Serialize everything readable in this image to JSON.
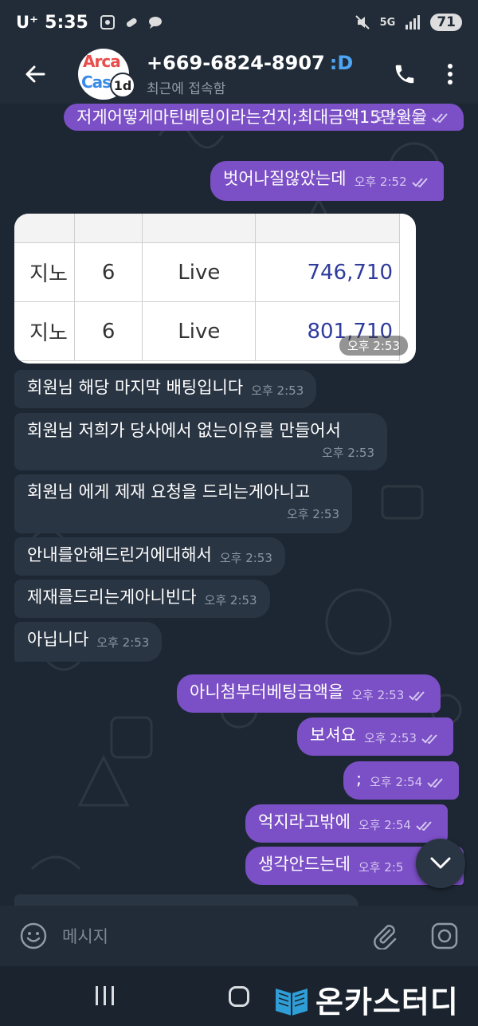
{
  "status_bar": {
    "carrier": "U⁺",
    "time": "5:35",
    "network": "5G",
    "battery": "71"
  },
  "header": {
    "contact_name": "+669-6824-8907",
    "emoticon": ":D",
    "status": "최근에 접속함",
    "avatar_text_1": "Arca",
    "avatar_text_2": "Cas",
    "avatar_badge": "1d"
  },
  "messages": [
    {
      "dir": "out",
      "text": "저게어떻게마틴베팅이라는건지;최대금액15만원을",
      "time": "오후 2:52"
    },
    {
      "dir": "out",
      "text": "벗어나질않았는데",
      "time": "오후 2:52"
    },
    {
      "dir": "in_image",
      "time": "오후 2:53"
    },
    {
      "dir": "in",
      "text": "회원님 해당 마지막 배팅입니다",
      "time": "오후 2:53"
    },
    {
      "dir": "in",
      "text": "회원님 저희가 당사에서 없는이유를 만들어서",
      "time": "오후 2:53"
    },
    {
      "dir": "in",
      "text": "회원님 에게 제재 요청을 드리는게아니고",
      "time": "오후 2:53"
    },
    {
      "dir": "in",
      "text": "안내를안해드린거에대해서",
      "time": "오후 2:53"
    },
    {
      "dir": "in",
      "text": "제재를드리는게아니빈다",
      "time": "오후 2:53"
    },
    {
      "dir": "in",
      "text": "아닙니다",
      "time": "오후 2:53"
    },
    {
      "dir": "out",
      "text": "아니첨부터베팅금액을",
      "time": "오후 2:53"
    },
    {
      "dir": "out",
      "text": "보셔요",
      "time": "오후 2:53"
    },
    {
      "dir": "out",
      "text": ";",
      "time": "오후 2:54"
    },
    {
      "dir": "out",
      "text": "억지라고밖에",
      "time": "오후 2:54"
    },
    {
      "dir": "out",
      "text": "생각안드는데",
      "time": "오후 2:5"
    }
  ],
  "image_table": {
    "header": [
      "",
      "",
      "",
      ""
    ],
    "rows": [
      {
        "game": "지노",
        "count": "6",
        "type": "Live",
        "amount": "746,710"
      },
      {
        "game": "지노",
        "count": "6",
        "type": "Live",
        "amount": "801,710"
      }
    ]
  },
  "input": {
    "placeholder": "메시지"
  },
  "watermark": {
    "text": "온카스터디"
  },
  "colors": {
    "outgoing_bubble": "#7b4fc5",
    "incoming_bubble": "#2a3543",
    "background": "#1d2733",
    "header": "#222c38"
  },
  "icons": {
    "back": "arrow-left-icon",
    "call": "phone-icon",
    "more": "more-vertical-icon",
    "emoji": "smiley-icon",
    "attach": "paperclip-icon",
    "camera": "camera-icon",
    "scroll": "chevron-down-icon"
  }
}
